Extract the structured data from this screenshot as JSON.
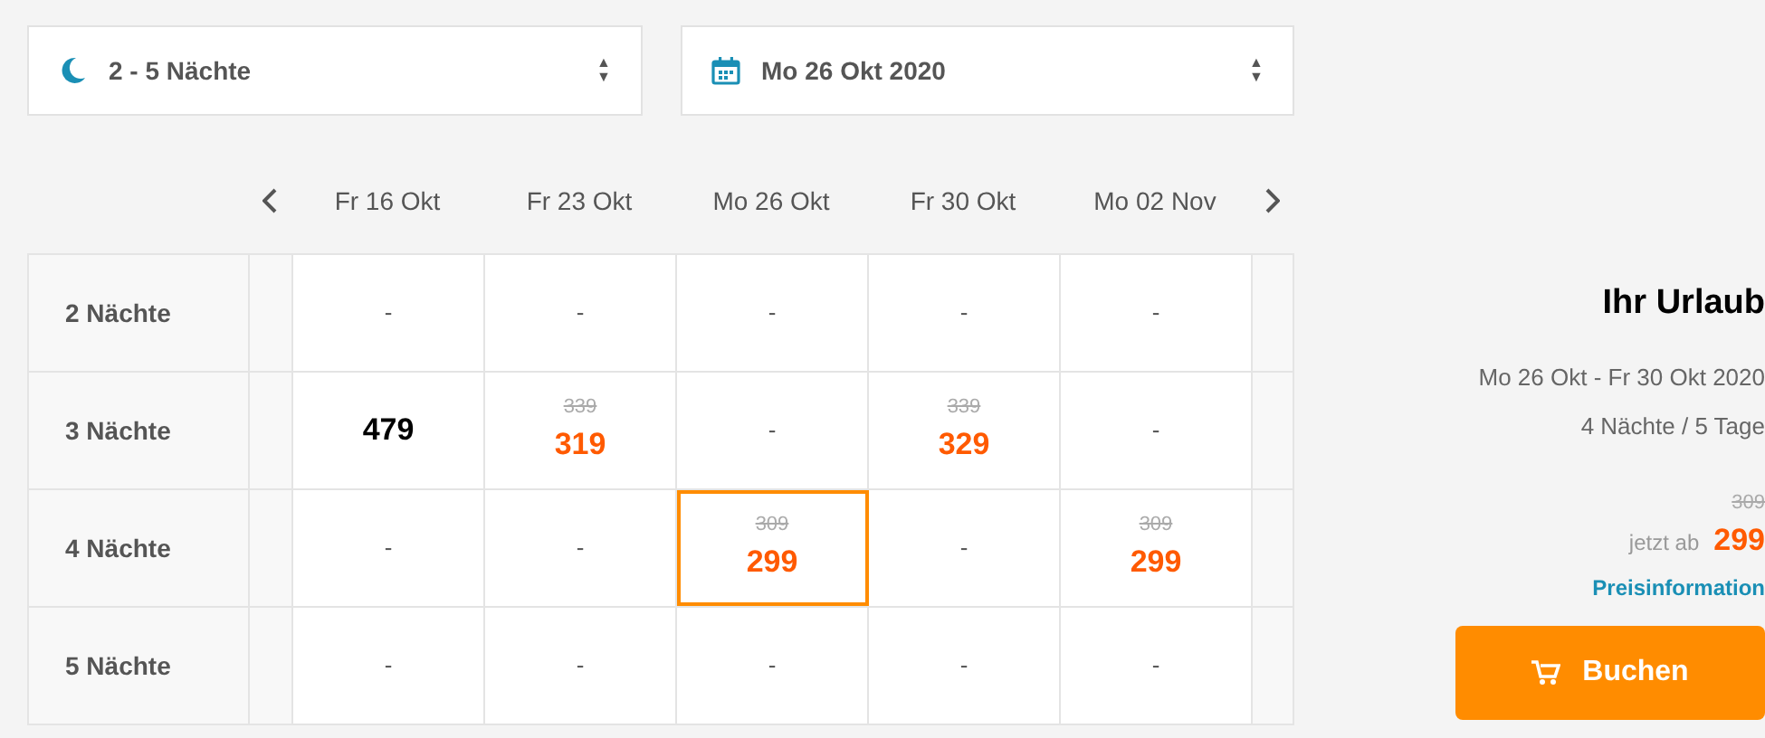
{
  "filters": [
    {
      "kind": "nights",
      "value": "2 - 5 Nächte",
      "arrows": "▲▼"
    },
    {
      "kind": "date",
      "value": "Mo 26 Okt 2020",
      "arrows": "▲▼"
    }
  ],
  "dates": [
    "Fr 16 Okt",
    "Fr 23 Okt",
    "Mo 26 Okt",
    "Fr 30 Okt",
    "Mo 02 Nov"
  ],
  "rows": [
    {
      "label": "2 Nächte",
      "cells": [
        {
          "kind": "empty",
          "text": "-",
          "selected": false
        },
        {
          "kind": "empty",
          "text": "-",
          "selected": false
        },
        {
          "kind": "empty",
          "text": "-",
          "selected": false
        },
        {
          "kind": "empty",
          "text": "-",
          "selected": false
        },
        {
          "kind": "empty",
          "text": "-",
          "selected": false
        }
      ]
    },
    {
      "label": "3 Nächte",
      "cells": [
        {
          "kind": "price",
          "price": "479",
          "selected": false
        },
        {
          "kind": "price",
          "old": "339",
          "price": "319",
          "selected": false
        },
        {
          "kind": "empty",
          "text": "-",
          "selected": false
        },
        {
          "kind": "price",
          "old": "339",
          "price": "329",
          "selected": false
        },
        {
          "kind": "empty",
          "text": "-",
          "selected": false
        }
      ]
    },
    {
      "label": "4 Nächte",
      "cells": [
        {
          "kind": "empty",
          "text": "-",
          "selected": false
        },
        {
          "kind": "empty",
          "text": "-",
          "selected": false
        },
        {
          "kind": "price",
          "old": "309",
          "price": "299",
          "selected": true
        },
        {
          "kind": "empty",
          "text": "-",
          "selected": false
        },
        {
          "kind": "price",
          "old": "309",
          "price": "299",
          "selected": false
        }
      ]
    },
    {
      "label": "5 Nächte",
      "cells": [
        {
          "kind": "empty",
          "text": "-",
          "selected": false
        },
        {
          "kind": "empty",
          "text": "-",
          "selected": false
        },
        {
          "kind": "empty",
          "text": "-",
          "selected": false
        },
        {
          "kind": "empty",
          "text": "-",
          "selected": false
        },
        {
          "kind": "empty",
          "text": "-",
          "selected": false
        }
      ]
    }
  ],
  "summary": {
    "title": "Ihr Urlaub",
    "dates": "Mo 26 Okt - Fr 30 Okt 2020",
    "duration": "4 Nächte / 5 Tage",
    "old_price": "309",
    "price_prefix": "jetzt ab",
    "price": "299",
    "link": "Preisinformation",
    "button": "Buchen"
  }
}
